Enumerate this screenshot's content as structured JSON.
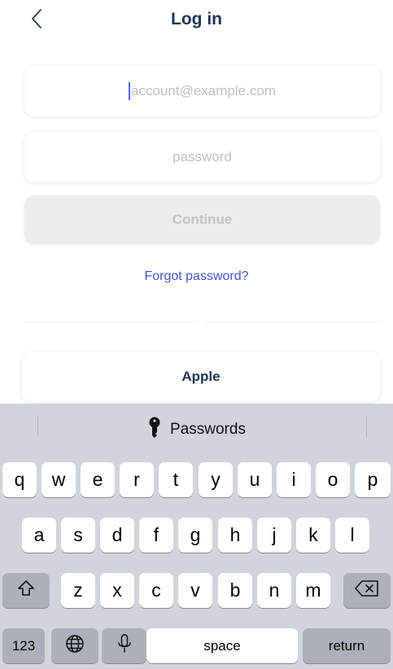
{
  "header": {
    "title": "Log in",
    "back_icon": "chevron-left-icon"
  },
  "form": {
    "email_placeholder": "account@example.com",
    "password_placeholder": "password",
    "continue_label": "Continue",
    "forgot_label": "Forgot password?",
    "apple_label": "Apple"
  },
  "keyboard": {
    "passwords_label": "Passwords",
    "row1": [
      "q",
      "w",
      "e",
      "r",
      "t",
      "y",
      "u",
      "i",
      "o",
      "p"
    ],
    "row2": [
      "a",
      "s",
      "d",
      "f",
      "g",
      "h",
      "j",
      "k",
      "l"
    ],
    "row3": [
      "z",
      "x",
      "c",
      "v",
      "b",
      "n",
      "m"
    ],
    "numbers_label": "123",
    "space_label": "space",
    "return_label": "return"
  },
  "colors": {
    "title": "#1e3555",
    "link": "#3e55c9",
    "keyboard_bg": "#d1d4da",
    "caret": "#3b6ef6"
  }
}
